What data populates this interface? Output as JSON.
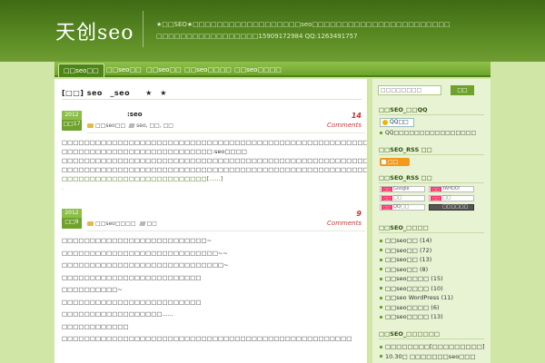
{
  "header": {
    "logo": "天创seo",
    "tagline_line1": "★□□SEO★□□□□□□□□□□□□□□□□□□seo□□□□□□□□□□□□□□□□□□□□□□□",
    "tagline_line2": "□□□□□□□□□□□□□□□□□15909172984 QQ:1263491757"
  },
  "nav": {
    "items": [
      {
        "label": "□□seo□□"
      },
      {
        "label": "□□seo□□"
      },
      {
        "label": "□□seo□□"
      },
      {
        "label": "□□seo□□□□"
      },
      {
        "label": "□□seo□□□□"
      }
    ]
  },
  "main": {
    "archive_title": "[□□] seo　_seo　　★　★",
    "posts": [
      {
        "year": "2012",
        "date": "□□17",
        "title": ":seo",
        "comments_count": "14",
        "comments_label": "Comments",
        "category": "□□seo□□",
        "tags": "seo, □□, □□",
        "body_lines": [
          "□□□□□□□□□□□□□□□□□□□□□□□□□□□□□□□□□□□□□□□□□□□□□□□□□□□□□□□□□□□□□□□□□□□",
          "□□□□□□□□□□□□□□□□□□□□□□□□□□□:seo□□□□",
          "□□□□□□□□□□□□□□□□□□□□□□□□□□□□□□□□□□□□□□□□□□□□□□□□□□□□□□□□□□□□□□□□□□□",
          "□□□□□□□□□□□□□□□□□□□□□□□□□□□□□□□□□□□□□□□□□□□□□□□□□□□□□□□□□□□□□□□□",
          "□□□□□□□□□□□□□□□□□□□□□□□□□□[......]"
        ],
        "more_marker": "."
      },
      {
        "year": "2012",
        "date": "□□9",
        "title": "",
        "comments_count": "9",
        "comments_label": "Comments",
        "category": "□□seo□□□□",
        "tags": "□□",
        "body_lines": [
          "□□□□□□□□□□□□□□□□□□□□□□□□□□~",
          "□□□□□□□□□□□□□□□□□□□□□□□□□□□□~~",
          "□□□□□□□□□□□□□□□□□□□□□□□□□□□□□~",
          "□□□□□□□□□□□□□□□□□□□□□□□□□",
          "□□□□□□□□□□~",
          "□□□□□□□□□□□□□□□□□□□□□□□□□",
          "□□□□□□□□□□□□□□□□□□......",
          "□□□□□□□□□□□□",
          "□□□□□□□□□□□□□□□□□□□□□□□□□□□□□□□□□□□□□□□□□□□□□□□□□□□□"
        ]
      }
    ]
  },
  "sidebar": {
    "search": {
      "placeholder": "□□□□□□□□",
      "button": "□□"
    },
    "qq_heading": "□□SEO_□□QQ",
    "qq_button": "QQ□□",
    "qq_text": "QQ□□□□□□□□□□□□□□□□",
    "rss_heading": "□□SEO_RSS □□",
    "rss_button": "□□",
    "feed_heading": "□□SEO_RSS □□",
    "feeds": [
      {
        "plus": "□□",
        "label": "Google"
      },
      {
        "plus": "□□",
        "label": "YAHOO!"
      },
      {
        "plus": "□□",
        "label": "□□"
      },
      {
        "plus": "□□",
        "label": "□□"
      },
      {
        "plus": "□□",
        "label": "QQ□□"
      },
      {
        "plus": "",
        "label": "□□□□□□"
      }
    ],
    "categories_heading": "□□SEO_□□□□",
    "categories": [
      {
        "label": "□□seo□□ (14)"
      },
      {
        "label": "□□seo□□ (72)"
      },
      {
        "label": "□□seo□□ (13)"
      },
      {
        "label": "□□seo□□ (8)"
      },
      {
        "label": "□□seo□□□□ (15)"
      },
      {
        "label": "□□seo□□□□ (10)"
      },
      {
        "label": "□□seo WordPress (11)"
      },
      {
        "label": "□□seo□□□□ (6)"
      },
      {
        "label": "□□seo□□□□ (13)"
      }
    ],
    "recent_heading": "□□SEO_□□□□□□",
    "recent": [
      {
        "label": "□□□□□□□□[□□□□□□□□□]"
      },
      {
        "label": "10.30□ □□□□□□□seo□□□"
      }
    ]
  }
}
